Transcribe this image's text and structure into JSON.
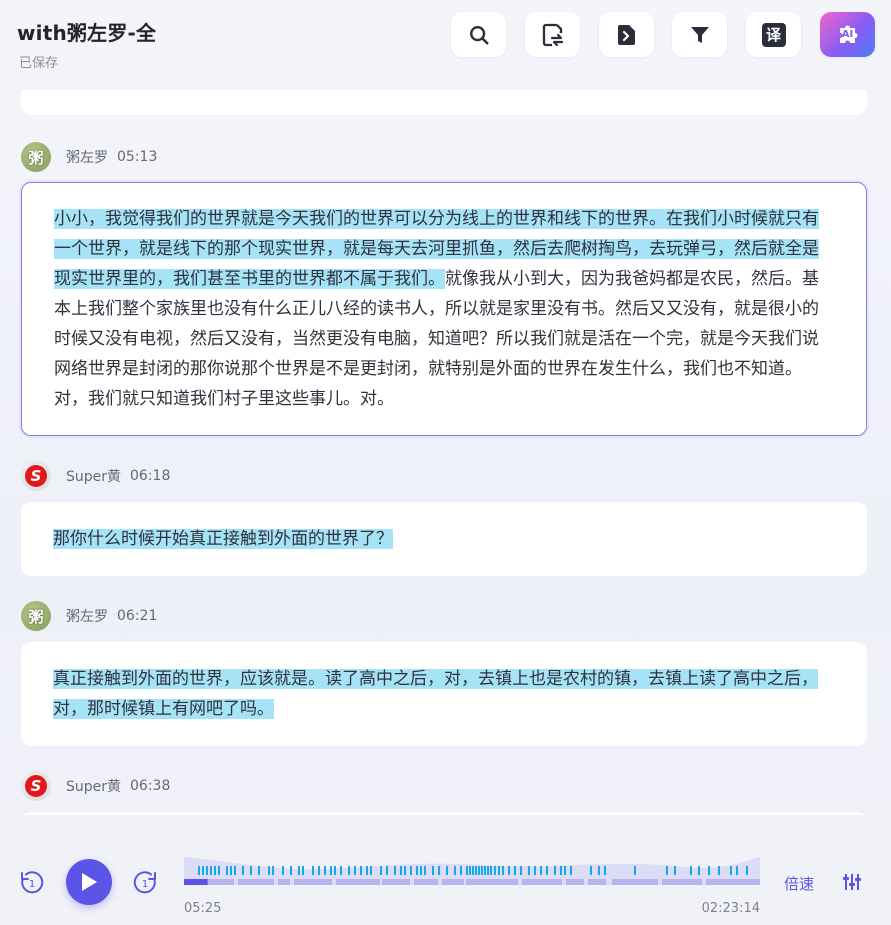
{
  "header": {
    "title": "with粥左罗-全",
    "status": "已保存",
    "ai_label": "AI"
  },
  "colors": {
    "accent": "#5b54e6",
    "highlight": "#a6e3f7",
    "active_border": "#8b80e6"
  },
  "icons": [
    "search-icon",
    "replace-icon",
    "export-icon",
    "filter-icon",
    "translate-icon",
    "ai-assistant-icon"
  ],
  "toolbar": {
    "translate_glyph": "译"
  },
  "transcript": [
    {
      "speaker": "粥左罗",
      "avatar": "粥",
      "time": "05:13",
      "highlight": "小小，我觉得我们的世界就是今天我们的世界可以分为线上的世界和线下的世界。在我们小时候就只有一个世界，就是线下的那个现实世界，就是每天去河里抓鱼，然后去爬树掏鸟，去玩弹弓，然后就全是现实世界里的，我们甚至书里的世界都不属于我们。",
      "text": "就像我从小到大，因为我爸妈都是农民，然后。基本上我们整个家族里也没有什么正儿八经的读书人，所以就是家里没有书。然后又又没有，就是很小的时候又没有电视，然后又没有，当然更没有电脑，知道吧？所以我们就是活在一个完，就是今天我们说网络世界是封闭的那你说那个世界是不是更封闭，就特别是外面的世界在发生什么，我们也不知道。对，我们就只知道我们村子里这些事儿。对。"
    },
    {
      "speaker": "Super黄",
      "avatar": "S",
      "time": "06:18",
      "highlight": "那你什么时候开始真正接触到外面的世界了？",
      "text": ""
    },
    {
      "speaker": "粥左罗",
      "avatar": "粥",
      "time": "06:21",
      "highlight": "真正接触到外面的世界，应该就是。读了高中之后，对，去镇上也是农村的镇，去镇上读了高中之后，对，那时候镇上有网吧了吗。",
      "text": ""
    },
    {
      "speaker": "Super黄",
      "avatar": "S",
      "time": "06:38",
      "highlight": "",
      "text": ""
    }
  ],
  "player": {
    "current_time": "05:25",
    "total_time": "02:23:14",
    "progress": 0.041,
    "speed_label": "倍速",
    "skip_back_label": "1",
    "skip_forward_label": "1"
  }
}
